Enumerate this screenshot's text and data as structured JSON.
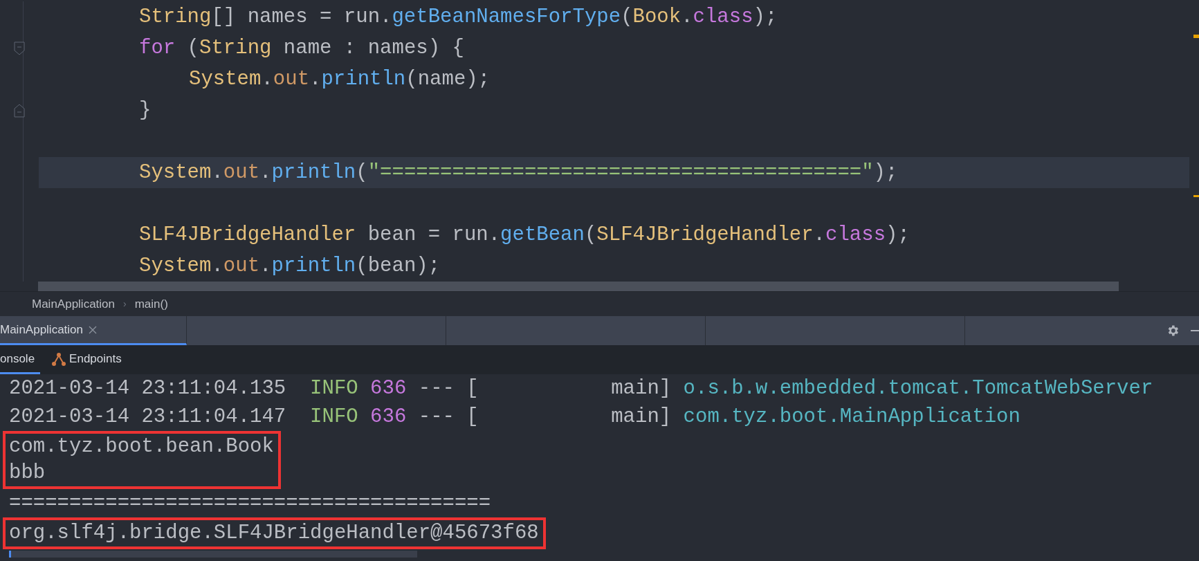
{
  "editor": {
    "lines": [
      {
        "current": false,
        "kind": "code",
        "tokens": [
          {
            "text": "String",
            "kind": "type"
          },
          {
            "text": "[] names = run.",
            "kind": "plain"
          },
          {
            "text": "getBeanNamesForType",
            "kind": "method"
          },
          {
            "text": "(",
            "kind": "plain"
          },
          {
            "text": "Book",
            "kind": "type"
          },
          {
            "text": ".",
            "kind": "plain"
          },
          {
            "text": "class",
            "kind": "keyword"
          },
          {
            "text": ");",
            "kind": "plain"
          }
        ]
      },
      {
        "current": false,
        "kind": "fold_start",
        "tokens": [
          {
            "text": "for",
            "kind": "keyword"
          },
          {
            "text": " (",
            "kind": "plain"
          },
          {
            "text": "String",
            "kind": "type"
          },
          {
            "text": " name : names) {",
            "kind": "plain"
          }
        ],
        "children": [
          {
            "current": false,
            "kind": "code",
            "tokens": [
              {
                "text": "System",
                "kind": "type"
              },
              {
                "text": ".",
                "kind": "plain"
              },
              {
                "text": "out",
                "kind": "field"
              },
              {
                "text": ".",
                "kind": "plain"
              },
              {
                "text": "println",
                "kind": "method"
              },
              {
                "text": "(name);",
                "kind": "plain"
              }
            ]
          }
        ]
      },
      {
        "current": false,
        "kind": "fold_end",
        "tokens": [
          {
            "text": "}",
            "kind": "plain"
          }
        ]
      },
      {
        "current": false,
        "kind": "blank"
      },
      {
        "current": true,
        "kind": "code",
        "tokens": [
          {
            "text": "System",
            "kind": "type"
          },
          {
            "text": ".",
            "kind": "plain"
          },
          {
            "text": "out",
            "kind": "field"
          },
          {
            "text": ".",
            "kind": "plain"
          },
          {
            "text": "println",
            "kind": "method"
          },
          {
            "text": "(",
            "kind": "plain"
          },
          {
            "text": "\"========================================\"",
            "kind": "string"
          },
          {
            "text": ");",
            "kind": "plain"
          }
        ]
      },
      {
        "current": false,
        "kind": "blank"
      },
      {
        "current": false,
        "kind": "code",
        "tokens": [
          {
            "text": "SLF4JBridgeHandler",
            "kind": "type"
          },
          {
            "text": " bean = run.",
            "kind": "plain"
          },
          {
            "text": "getBean",
            "kind": "method"
          },
          {
            "text": "(",
            "kind": "plain"
          },
          {
            "text": "SLF4JBridgeHandler",
            "kind": "type"
          },
          {
            "text": ".",
            "kind": "plain"
          },
          {
            "text": "class",
            "kind": "keyword"
          },
          {
            "text": ");",
            "kind": "plain"
          }
        ]
      },
      {
        "current": false,
        "kind": "code",
        "tokens": [
          {
            "text": "System",
            "kind": "type"
          },
          {
            "text": ".",
            "kind": "plain"
          },
          {
            "text": "out",
            "kind": "field"
          },
          {
            "text": ".",
            "kind": "plain"
          },
          {
            "text": "println",
            "kind": "method"
          },
          {
            "text": "(bean);",
            "kind": "plain"
          }
        ]
      }
    ]
  },
  "breadcrumb": {
    "items": [
      "MainApplication",
      "main()"
    ],
    "separator": "›"
  },
  "run_tabs": [
    {
      "label": "MainApplication",
      "selected": true
    }
  ],
  "console_tabs": [
    {
      "label": "onsole",
      "selected": true,
      "kind": "console"
    },
    {
      "label": "Endpoints",
      "selected": false,
      "kind": "endpoints"
    }
  ],
  "console": [
    {
      "kind": "line",
      "tokens": [
        {
          "text": "2021-03-14 23:11:04.135  ",
          "kind": "plain"
        },
        {
          "text": "INFO",
          "kind": "info"
        },
        {
          "text": " 636",
          "kind": "pid"
        },
        {
          "text": " --- [           main] ",
          "kind": "plain"
        },
        {
          "text": "o.s.b.w.embedded.tomcat.TomcatWebServer",
          "kind": "logger"
        }
      ]
    },
    {
      "kind": "line",
      "tokens": [
        {
          "text": "2021-03-14 23:11:04.147  ",
          "kind": "plain"
        },
        {
          "text": "INFO",
          "kind": "info"
        },
        {
          "text": " 636",
          "kind": "pid"
        },
        {
          "text": " --- [           main] ",
          "kind": "plain"
        },
        {
          "text": "com.tyz.boot.MainApplication",
          "kind": "logger"
        }
      ]
    },
    {
      "kind": "boxed",
      "lines": [
        "com.tyz.boot.bean.Book",
        "bbb"
      ]
    },
    {
      "kind": "line",
      "tokens": [
        {
          "text": "========================================",
          "kind": "plain"
        }
      ]
    },
    {
      "kind": "boxed",
      "lines": [
        "org.slf4j.bridge.SLF4JBridgeHandler@45673f68"
      ]
    }
  ]
}
